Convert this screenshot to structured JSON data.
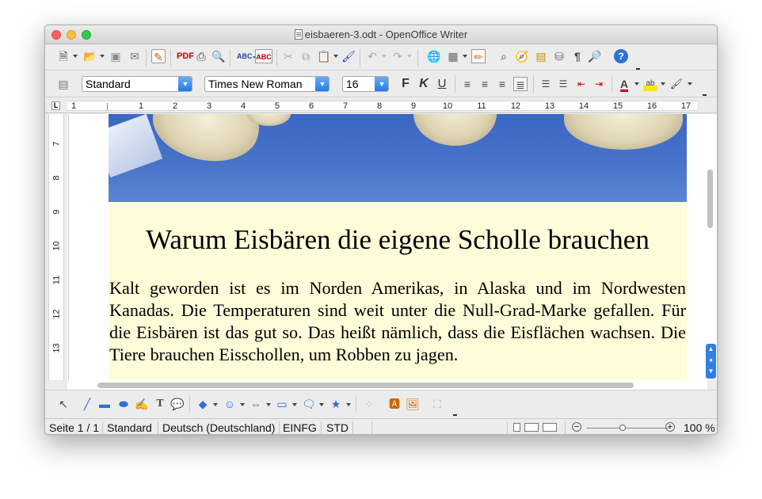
{
  "window": {
    "title": "eisbaeren-3.odt - OpenOffice Writer"
  },
  "toolbar_standard": {
    "icons": [
      "new-doc-icon",
      "open-folder-icon",
      "save-icon",
      "mail-icon",
      "edit-mode-icon",
      "export-pdf-icon",
      "print-icon",
      "print-preview-icon",
      "spellcheck-icon",
      "autospell-icon",
      "cut-icon",
      "copy-icon",
      "paste-icon",
      "format-paintbrush-icon",
      "undo-icon",
      "redo-icon",
      "navigator-globe-icon",
      "table-icon",
      "draw-show-icon",
      "find-binoculars-icon",
      "navigator-compass-icon",
      "gallery-icon",
      "datasources-icon",
      "formatting-marks-icon",
      "zoom-magnifier-icon",
      "help-icon"
    ]
  },
  "toolbar_formatting": {
    "paragraph_style": "Standard",
    "font_name": "Times New Roman",
    "font_size": "16",
    "bold_label": "F",
    "italic_label": "K",
    "underline_label": "U",
    "font_color": "#d0021b",
    "highlight_color": "#f8e71c"
  },
  "ruler": {
    "h_numbers": [
      "1",
      "1",
      "2",
      "3",
      "4",
      "5",
      "6",
      "7",
      "8",
      "9",
      "10",
      "11",
      "12",
      "13",
      "14",
      "15",
      "16",
      "17"
    ],
    "v_numbers": [
      "7",
      "8",
      "9",
      "10",
      "11",
      "12",
      "13"
    ],
    "corner_label": "L"
  },
  "document": {
    "heading": "Warum Eisbären die eigene Scholle brauchen",
    "paragraph": "Kalt geworden ist es im Norden Amerikas, in Alaska und im Nordwesten Kanadas. Die Temperaturen sind weit unter die Null-Grad-Marke gefallen. Für die Eisbären ist das gut so. Das heißt nämlich, dass die Eisflächen wachsen. Die Tiere brauchen Eisschollen, um Robben zu jagen.",
    "background_color": "#fefcd9"
  },
  "status_bar": {
    "page": "Seite 1 / 1",
    "style": "Standard",
    "language": "Deutsch (Deutschland)",
    "insert_mode": "EINFG",
    "selection_mode": "STD",
    "zoom": "100 %"
  }
}
